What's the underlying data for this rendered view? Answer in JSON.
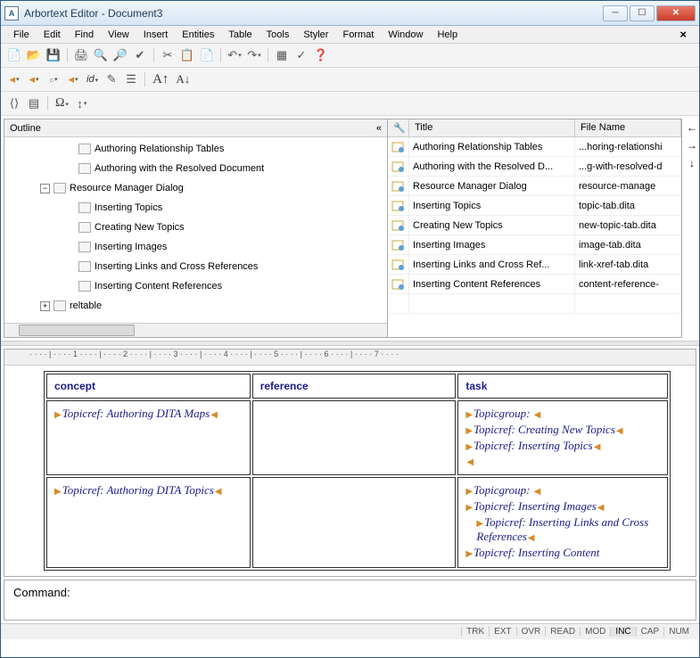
{
  "window": {
    "title": "Arbortext Editor - Document3"
  },
  "menu": [
    "File",
    "Edit",
    "Find",
    "View",
    "Insert",
    "Entities",
    "Table",
    "Tools",
    "Styler",
    "Format",
    "Window",
    "Help"
  ],
  "outline": {
    "header": "Outline",
    "items": [
      {
        "indent": 68,
        "expander": "",
        "label": "Authoring Relationship Tables"
      },
      {
        "indent": 68,
        "expander": "",
        "label": "Authoring with the Resolved Document"
      },
      {
        "indent": 40,
        "expander": "−",
        "label": "Resource Manager Dialog"
      },
      {
        "indent": 68,
        "expander": "",
        "label": "Inserting Topics"
      },
      {
        "indent": 68,
        "expander": "",
        "label": "Creating New Topics"
      },
      {
        "indent": 68,
        "expander": "",
        "label": "Inserting Images"
      },
      {
        "indent": 68,
        "expander": "",
        "label": "Inserting Links and Cross References"
      },
      {
        "indent": 68,
        "expander": "",
        "label": "Inserting Content References"
      },
      {
        "indent": 40,
        "expander": "+",
        "label": "reltable"
      }
    ]
  },
  "table": {
    "headers": {
      "icon": "",
      "title": "Title",
      "file": "File Name"
    },
    "rows": [
      {
        "title": "Authoring Relationship Tables",
        "file": "...horing-relationshi"
      },
      {
        "title": "Authoring with the Resolved D...",
        "file": "...g-with-resolved-d"
      },
      {
        "title": "Resource Manager Dialog",
        "file": "resource-manage"
      },
      {
        "title": "Inserting Topics",
        "file": "topic-tab.dita"
      },
      {
        "title": "Creating New Topics",
        "file": "new-topic-tab.dita"
      },
      {
        "title": "Inserting Images",
        "file": "image-tab.dita"
      },
      {
        "title": "Inserting Links and Cross Ref...",
        "file": "link-xref-tab.dita"
      },
      {
        "title": "Inserting Content References",
        "file": "content-reference-"
      },
      {
        "title": "",
        "file": ""
      }
    ]
  },
  "reltable": {
    "headers": [
      "concept",
      "reference",
      "task"
    ],
    "rows": [
      {
        "concept": [
          {
            "tag": "Topicref:",
            "text": "Authoring DITA Maps",
            "end": true
          }
        ],
        "reference": [],
        "task": [
          {
            "tag": "Topicgroup:",
            "text": "",
            "end": true
          },
          {
            "tag": "Topicref:",
            "text": "Creating New Topics",
            "end": true
          },
          {
            "tag": "Topicref:",
            "text": "Inserting Topics",
            "end": true
          },
          {
            "tag": "",
            "text": "",
            "end": true,
            "endonly": true
          }
        ]
      },
      {
        "concept": [
          {
            "tag": "Topicref:",
            "text": "Authoring DITA Topics",
            "end": true
          }
        ],
        "reference": [],
        "task": [
          {
            "tag": "Topicgroup:",
            "text": "",
            "end": true
          },
          {
            "tag": "Topicref:",
            "text": "Inserting Images",
            "end": true
          },
          {
            "tag": "Topicref:",
            "text": "Inserting Links and Cross References",
            "end": true,
            "wrap": true
          },
          {
            "tag": "Topicref:",
            "text": "Inserting Content",
            "end": false
          }
        ]
      }
    ]
  },
  "command": {
    "label": "Command:"
  },
  "status": [
    "TRK",
    "EXT",
    "OVR",
    "READ",
    "MOD",
    "INC",
    "CAP",
    "NUM"
  ],
  "status_active": "INC"
}
